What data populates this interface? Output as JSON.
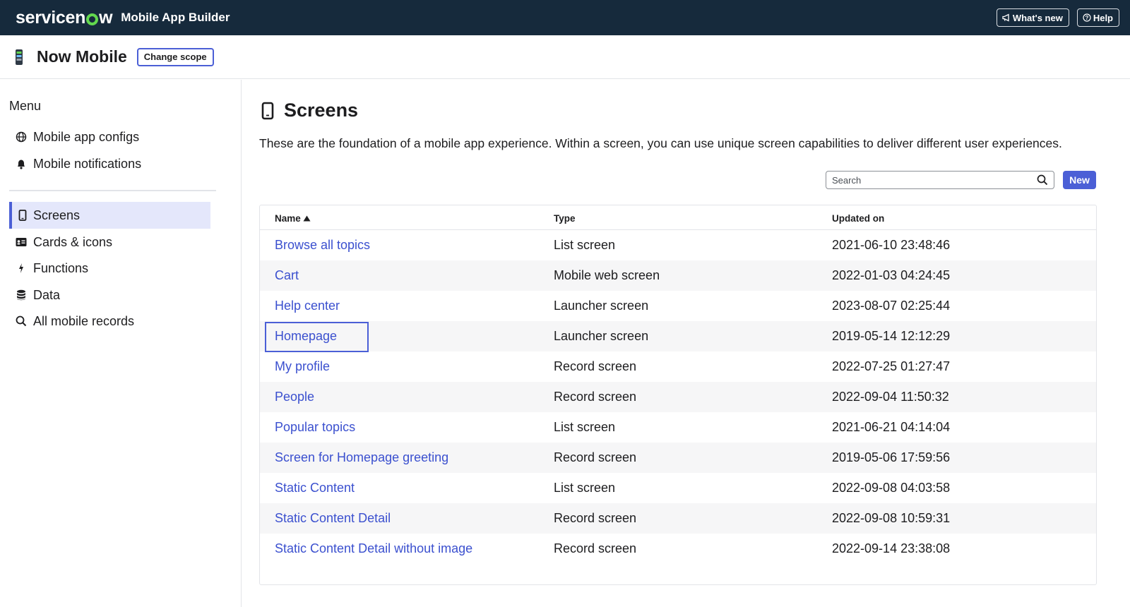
{
  "topbar": {
    "logo_prefix": "servicen",
    "logo_suffix": "w",
    "product_name": "Mobile App Builder",
    "whats_new_label": "What's new",
    "help_label": "Help",
    "brand_color": "#162a3c",
    "logo_accent": "#62d84e"
  },
  "scope": {
    "title": "Now Mobile",
    "change_scope_label": "Change scope"
  },
  "sidebar": {
    "menu_title": "Menu",
    "items": [
      {
        "label": "Mobile app configs",
        "icon": "globe-icon"
      },
      {
        "label": "Mobile notifications",
        "icon": "bell-icon"
      },
      {
        "label": "Screens",
        "icon": "mobile-device-icon",
        "active": true
      },
      {
        "label": "Cards & icons",
        "icon": "card-icon"
      },
      {
        "label": "Functions",
        "icon": "lightning-icon"
      },
      {
        "label": "Data",
        "icon": "database-icon"
      },
      {
        "label": "All mobile records",
        "icon": "search-icon"
      }
    ]
  },
  "main": {
    "title": "Screens",
    "description": "These are the foundation of a mobile app experience. Within a screen, you can use unique screen capabilities to deliver different user experiences.",
    "search_placeholder": "Search",
    "new_label": "New",
    "accent": "#4b5fd6"
  },
  "table": {
    "columns": [
      "Name",
      "Type",
      "Updated on"
    ],
    "sorted_column": "Name",
    "sort_direction": "ascending",
    "rows": [
      {
        "name": "Browse all topics",
        "type": "List screen",
        "updated": "2021-06-10 23:48:46"
      },
      {
        "name": "Cart",
        "type": "Mobile web screen",
        "updated": "2022-01-03 04:24:45"
      },
      {
        "name": "Help center",
        "type": "Launcher screen",
        "updated": "2023-08-07 02:25:44"
      },
      {
        "name": "Homepage",
        "type": "Launcher screen",
        "updated": "2019-05-14 12:12:29",
        "focused": true
      },
      {
        "name": "My profile",
        "type": "Record screen",
        "updated": "2022-07-25 01:27:47"
      },
      {
        "name": "People",
        "type": "Record screen",
        "updated": "2022-09-04 11:50:32"
      },
      {
        "name": "Popular topics",
        "type": "List screen",
        "updated": "2021-06-21 04:14:04"
      },
      {
        "name": "Screen for Homepage greeting",
        "type": "Record screen",
        "updated": "2019-05-06 17:59:56"
      },
      {
        "name": "Static Content",
        "type": "List screen",
        "updated": "2022-09-08 04:03:58"
      },
      {
        "name": "Static Content Detail",
        "type": "Record screen",
        "updated": "2022-09-08 10:59:31"
      },
      {
        "name": "Static Content Detail without image",
        "type": "Record screen",
        "updated": "2022-09-14 23:38:08"
      }
    ]
  }
}
